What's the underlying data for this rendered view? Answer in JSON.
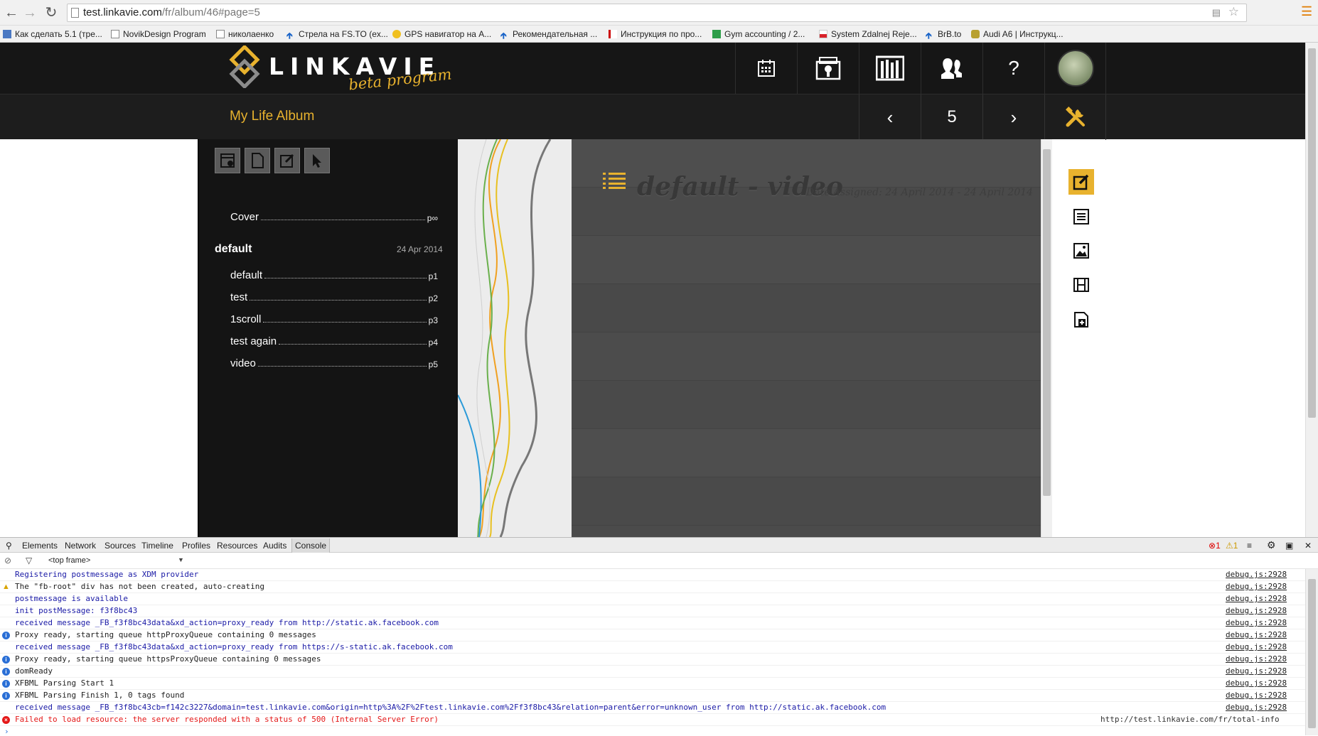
{
  "browser": {
    "url_host": "test.linkavie.com",
    "url_path": "/fr/album/46#page=5",
    "bookmarks": [
      "Как сделать 5.1 (тре...",
      "NovikDesign Program",
      "николаенко",
      "Стрела на FS.TO (ex...",
      "GPS навигатор на A...",
      "Рекомендательная ...",
      "Инструкция по про...",
      "Gym accounting / 2...",
      "System Zdalnej Reje...",
      "BrB.to",
      "Audi A6 | Инструкц..."
    ]
  },
  "site": {
    "logo_text": "LINKAVIE",
    "logo_sub": "beta program",
    "help_label": "?",
    "album_title": "My Life Album",
    "page_number": "5",
    "colors": {
      "accent": "#e8b22e",
      "header_bg": "#161616",
      "panel_bg": "#141414"
    }
  },
  "toc": {
    "cover": {
      "label": "Cover",
      "page": "p∞"
    },
    "section": {
      "title": "default",
      "date": "24 Apr 2014"
    },
    "items": [
      {
        "label": "default",
        "page": "p1"
      },
      {
        "label": "test",
        "page": "p2"
      },
      {
        "label": "1scroll",
        "page": "p3"
      },
      {
        "label": "test again",
        "page": "p4"
      },
      {
        "label": "video",
        "page": "p5"
      }
    ]
  },
  "page": {
    "title": "default - video",
    "date_line": "Date Assigned: 24 April 2014 - 24 April 2014"
  },
  "devtools": {
    "tabs": [
      "Elements",
      "Network",
      "Sources",
      "Timeline",
      "Profiles",
      "Resources",
      "Audits",
      "Console"
    ],
    "frame": "<top frame>",
    "error_count": "1",
    "warning_count": "1",
    "logs": [
      {
        "type": "log",
        "color": "blue",
        "msg": "Registering postmessage as XDM provider",
        "src": "debug.js:2928"
      },
      {
        "type": "warn",
        "color": "black",
        "msg": "The \"fb-root\" div has not been created, auto-creating",
        "src": "debug.js:2928"
      },
      {
        "type": "log",
        "color": "blue",
        "msg": "postmessage is available",
        "src": "debug.js:2928"
      },
      {
        "type": "log",
        "color": "blue",
        "msg": "init postMessage: f3f8bc43",
        "src": "debug.js:2928"
      },
      {
        "type": "log",
        "color": "blue",
        "msg": "received message _FB_f3f8bc43data&xd_action=proxy_ready from http://static.ak.facebook.com",
        "src": "debug.js:2928"
      },
      {
        "type": "info",
        "color": "black",
        "msg": "Proxy ready, starting queue httpProxyQueue containing 0 messages",
        "src": "debug.js:2928"
      },
      {
        "type": "log",
        "color": "blue",
        "msg": "received message _FB_f3f8bc43data&xd_action=proxy_ready from https://s-static.ak.facebook.com",
        "src": "debug.js:2928"
      },
      {
        "type": "info",
        "color": "black",
        "msg": "Proxy ready, starting queue httpsProxyQueue containing 0 messages",
        "src": "debug.js:2928"
      },
      {
        "type": "info",
        "color": "black",
        "msg": "domReady",
        "src": "debug.js:2928"
      },
      {
        "type": "info",
        "color": "black",
        "msg": "XFBML Parsing Start 1",
        "src": "debug.js:2928"
      },
      {
        "type": "info",
        "color": "black",
        "msg": "XFBML Parsing Finish 1, 0 tags found",
        "src": "debug.js:2928"
      },
      {
        "type": "log",
        "color": "blue",
        "msg": "received message _FB_f3f8bc43cb=f142c3227&domain=test.linkavie.com&origin=http%3A%2F%2Ftest.linkavie.com%2Ff3f8bc43&relation=parent&error=unknown_user from http://static.ak.facebook.com",
        "src": "debug.js:2928"
      },
      {
        "type": "error",
        "color": "red",
        "msg": "Failed to load resource: the server responded with a status of 500 (Internal Server Error)",
        "src": "http://test.linkavie.com/fr/total-info"
      }
    ]
  }
}
